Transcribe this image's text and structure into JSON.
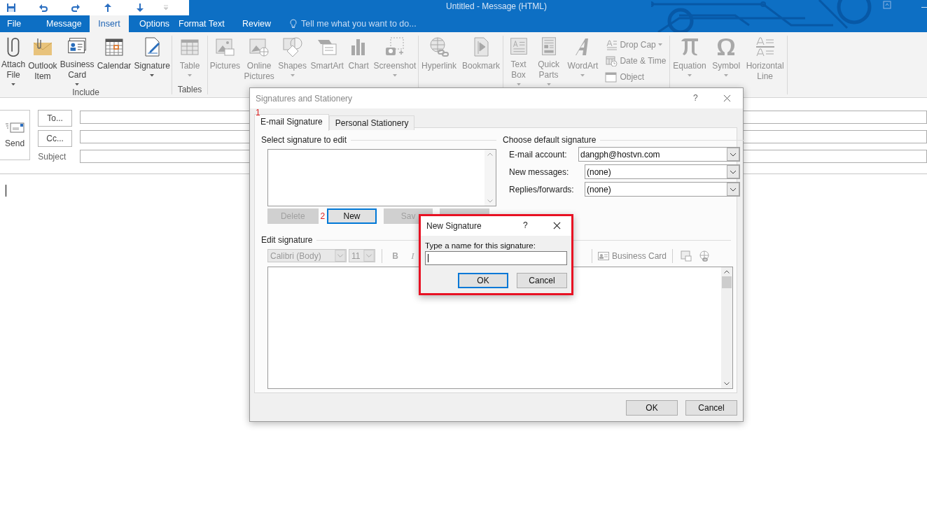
{
  "window": {
    "title": "Untitled - Message (HTML)"
  },
  "menu_tabs": [
    {
      "label": "File",
      "selected": false
    },
    {
      "label": "Message",
      "selected": false
    },
    {
      "label": "Insert",
      "selected": true
    },
    {
      "label": "Options",
      "selected": false
    },
    {
      "label": "Format Text",
      "selected": false
    },
    {
      "label": "Review",
      "selected": false
    }
  ],
  "tell_me": {
    "text": "Tell me what you want to do..."
  },
  "ribbon": {
    "groups": [
      {
        "label": "Include",
        "buttons": [
          {
            "lines": [
              "Attach",
              "File"
            ],
            "dropdown": true,
            "disabled": false
          },
          {
            "lines": [
              "Outlook",
              "Item"
            ],
            "dropdown": false,
            "disabled": false
          },
          {
            "lines": [
              "Business",
              "Card"
            ],
            "dropdown": true,
            "disabled": false
          },
          {
            "lines": [
              "Calendar"
            ],
            "dropdown": false,
            "disabled": false
          },
          {
            "lines": [
              "Signature"
            ],
            "dropdown": true,
            "disabled": false
          }
        ]
      },
      {
        "label": "Tables",
        "buttons": [
          {
            "lines": [
              "Table"
            ],
            "dropdown": true,
            "disabled": true
          }
        ]
      },
      {
        "buttons": [
          {
            "lines": [
              "Pictures"
            ],
            "dropdown": false,
            "disabled": true
          },
          {
            "lines": [
              "Online",
              "Pictures"
            ],
            "dropdown": false,
            "disabled": true
          },
          {
            "lines": [
              "Shapes"
            ],
            "dropdown": true,
            "disabled": true
          },
          {
            "lines": [
              "SmartArt"
            ],
            "dropdown": false,
            "disabled": true
          },
          {
            "lines": [
              "Chart"
            ],
            "dropdown": false,
            "disabled": true
          },
          {
            "lines": [
              "Screenshot"
            ],
            "dropdown": true,
            "disabled": true
          }
        ]
      },
      {
        "buttons": [
          {
            "lines": [
              "Hyperlink"
            ],
            "dropdown": false,
            "disabled": true
          },
          {
            "lines": [
              "Bookmark"
            ],
            "dropdown": false,
            "disabled": true
          }
        ]
      },
      {
        "buttons": [
          {
            "lines": [
              "Text",
              "Box"
            ],
            "dropdown": true,
            "disabled": true
          },
          {
            "lines": [
              "Quick",
              "Parts"
            ],
            "dropdown": true,
            "disabled": true
          },
          {
            "lines": [
              "WordArt"
            ],
            "dropdown": true,
            "disabled": true
          }
        ],
        "small_buttons": [
          {
            "label": "Drop Cap",
            "dropdown": true,
            "disabled": true
          },
          {
            "label": "Date & Time",
            "dropdown": false,
            "disabled": true
          },
          {
            "label": "Object",
            "dropdown": false,
            "disabled": true
          }
        ]
      },
      {
        "buttons": [
          {
            "lines": [
              "Equation"
            ],
            "dropdown": true,
            "disabled": true
          },
          {
            "lines": [
              "Symbol"
            ],
            "dropdown": true,
            "disabled": true
          },
          {
            "lines": [
              "Horizontal",
              "Line"
            ],
            "dropdown": false,
            "disabled": true
          }
        ]
      }
    ]
  },
  "compose": {
    "send": "Send",
    "to": "To...",
    "cc": "Cc...",
    "subject_label": "Subject"
  },
  "signatures_dialog": {
    "title": "Signatures and Stationery",
    "help": "?",
    "tabs": [
      {
        "label": "E-mail Signature",
        "selected": true,
        "step": "1"
      },
      {
        "label": "Personal Stationery",
        "selected": false
      }
    ],
    "select_heading": "Select signature to edit",
    "list_buttons": [
      {
        "label": "Delete",
        "disabled": true,
        "focused": false
      },
      {
        "label": "New",
        "disabled": false,
        "focused": true,
        "step": "2"
      },
      {
        "label": "Sav",
        "disabled": true,
        "focused": false
      },
      {
        "disabled": true,
        "focused": false
      }
    ],
    "default_heading": "Choose default signature",
    "defaults": [
      {
        "label": "E-mail account:",
        "value": "dangph@hostvn.com"
      },
      {
        "label": "New messages:",
        "value": "(none)"
      },
      {
        "label": "Replies/forwards:",
        "value": "(none)"
      }
    ],
    "edit_heading": "Edit signature",
    "font": "Calibri (Body)",
    "size": "11",
    "format_buttons": [
      "B",
      "I"
    ],
    "business_card": "Business Card",
    "buttons": [
      "OK",
      "Cancel"
    ]
  },
  "new_signature_dialog": {
    "title": "New Signature",
    "help": "?",
    "prompt": "Type a name for this signature:",
    "buttons": [
      {
        "label": "OK",
        "focused": true
      },
      {
        "label": "Cancel",
        "focused": false
      }
    ]
  }
}
